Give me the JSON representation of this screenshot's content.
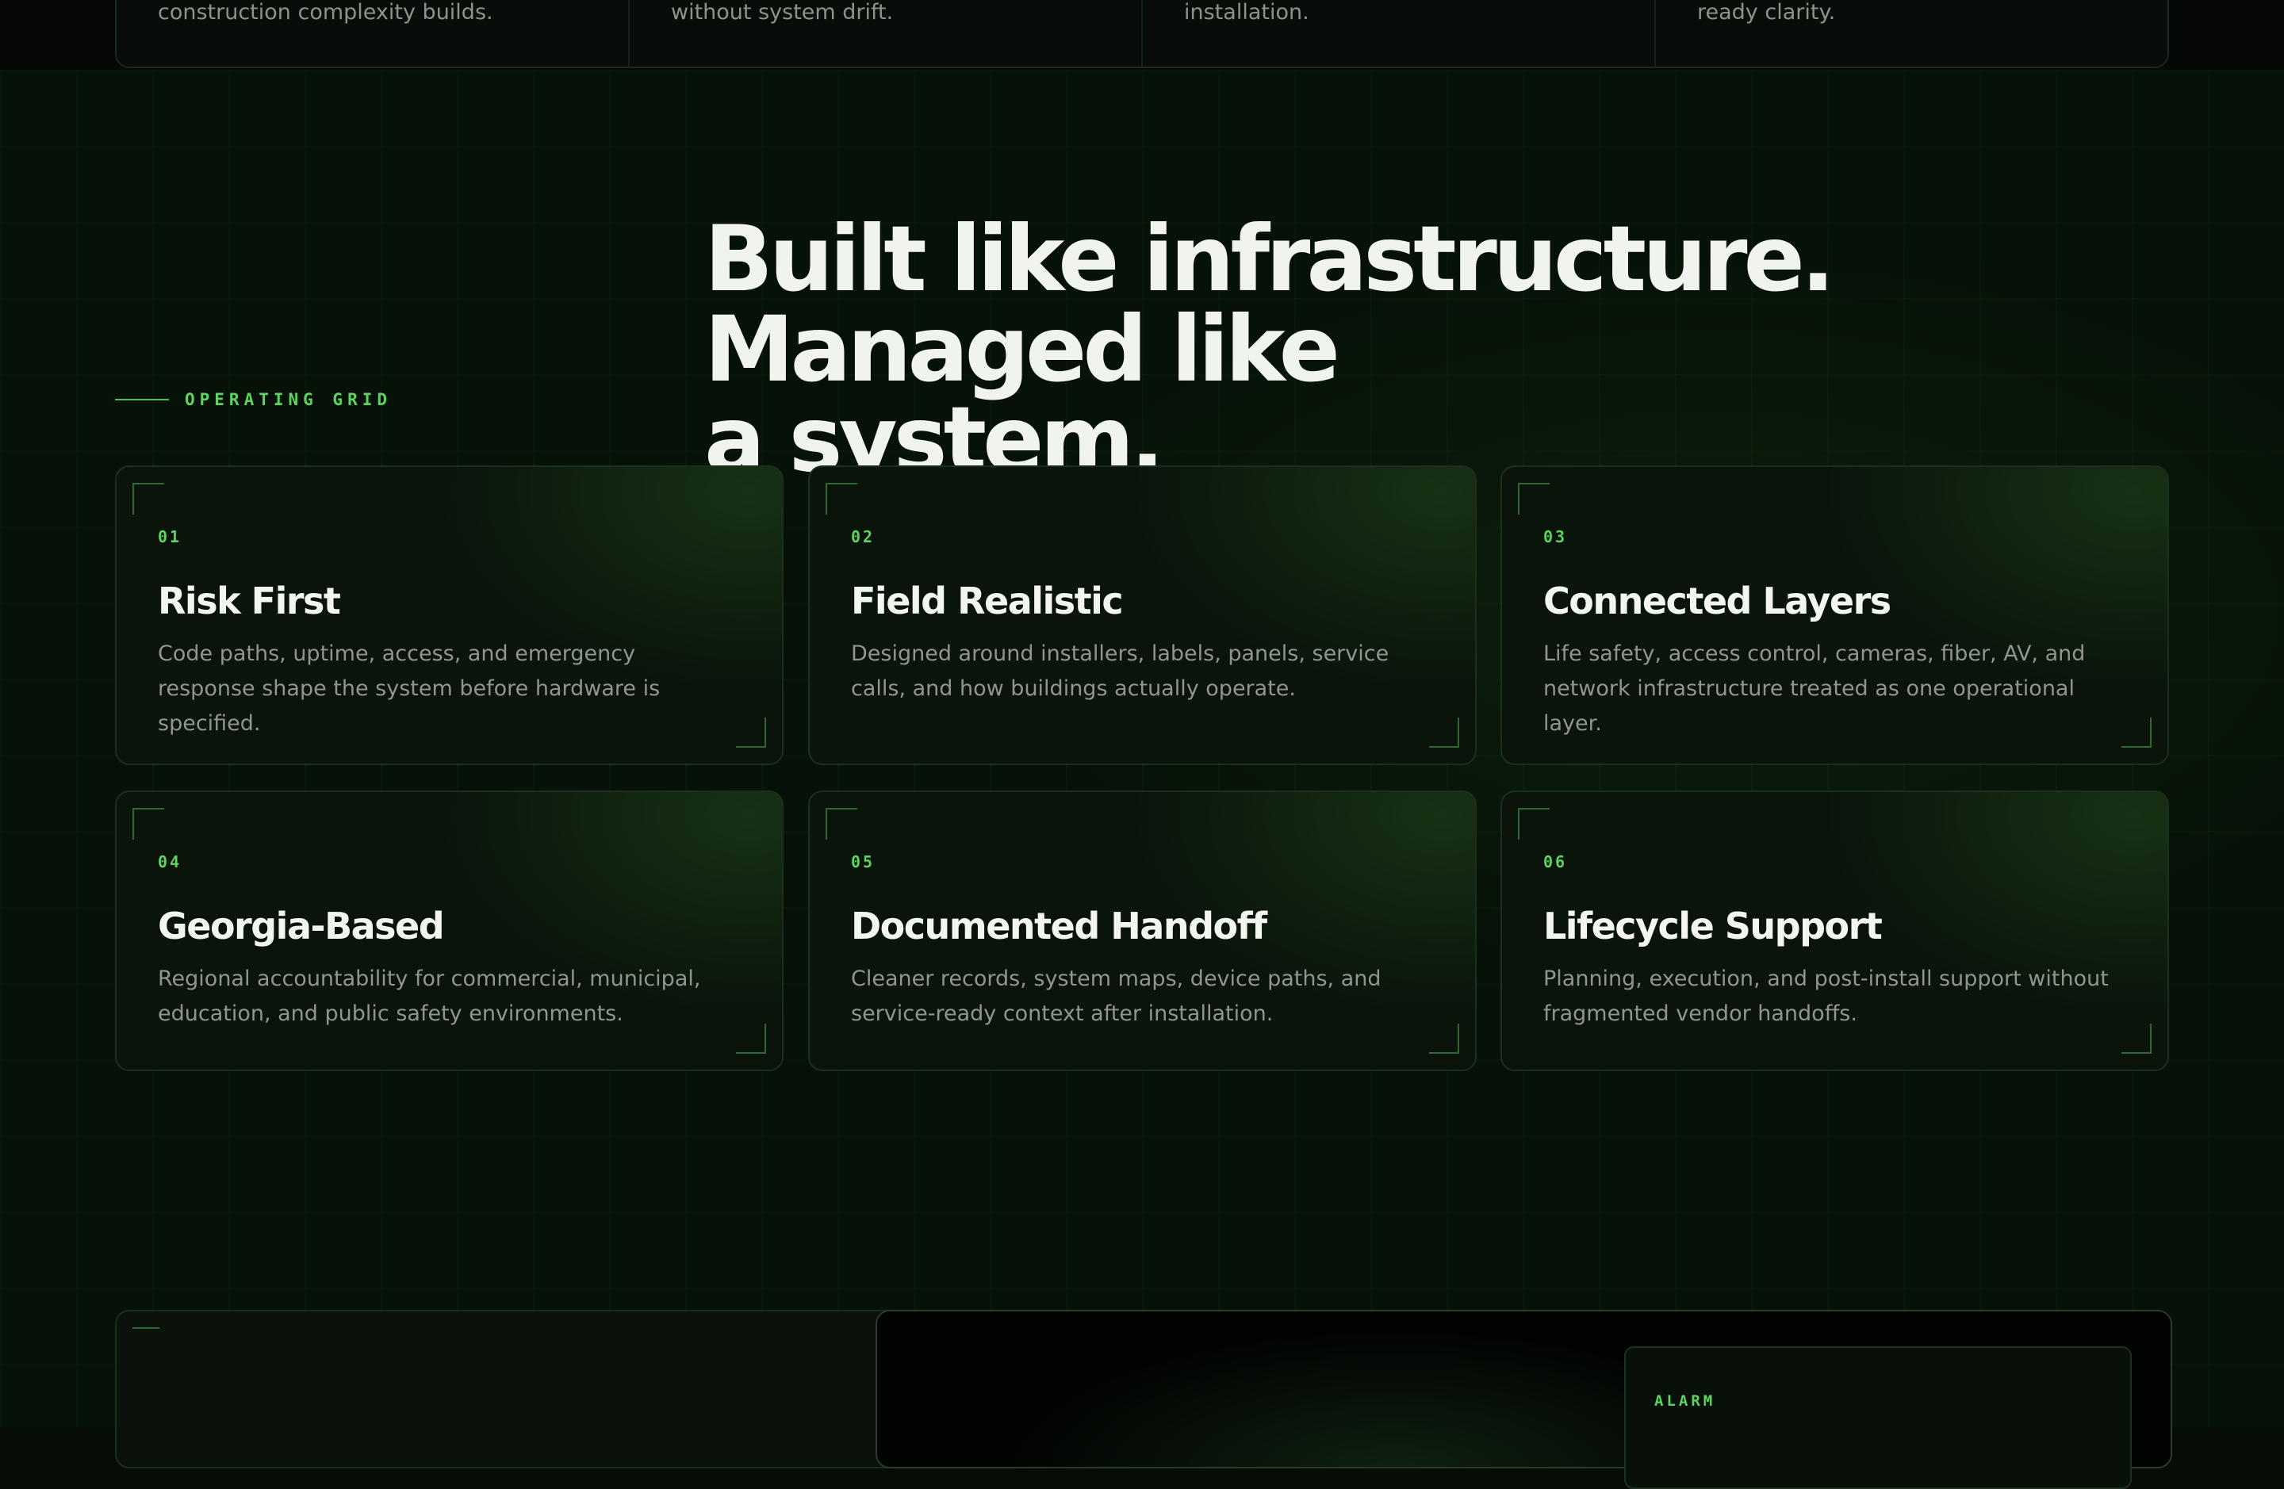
{
  "top_strip": {
    "cells": [
      "construction complexity builds.",
      "without system drift.",
      "installation.",
      "ready clarity."
    ]
  },
  "section": {
    "eyebrow": "OPERATING GRID",
    "headline_line1": "Built like infrastructure. Managed like",
    "headline_line2": "a system."
  },
  "cards": [
    {
      "num": "01",
      "title": "Risk First",
      "desc": "Code paths, uptime, access, and emergency response shape the system before hardware is specified."
    },
    {
      "num": "02",
      "title": "Field Realistic",
      "desc": "Designed around installers, labels, panels, service calls, and how buildings actually operate."
    },
    {
      "num": "03",
      "title": "Connected Layers",
      "desc": "Life safety, access control, cameras, fiber, AV, and network infrastructure treated as one operational layer."
    },
    {
      "num": "04",
      "title": "Georgia-Based",
      "desc": "Regional accountability for commercial, municipal, education, and public safety environments."
    },
    {
      "num": "05",
      "title": "Documented Handoff",
      "desc": "Cleaner records, system maps, device paths, and service-ready context after installation."
    },
    {
      "num": "06",
      "title": "Lifecycle Support",
      "desc": "Planning, execution, and post-install support without fragmented vendor handoffs."
    }
  ],
  "bottom": {
    "alarm_label": "ALARM"
  },
  "colors": {
    "accent": "#5cd45f",
    "background": "#061107",
    "text": "#f1f3ee",
    "muted": "#8f978d"
  }
}
